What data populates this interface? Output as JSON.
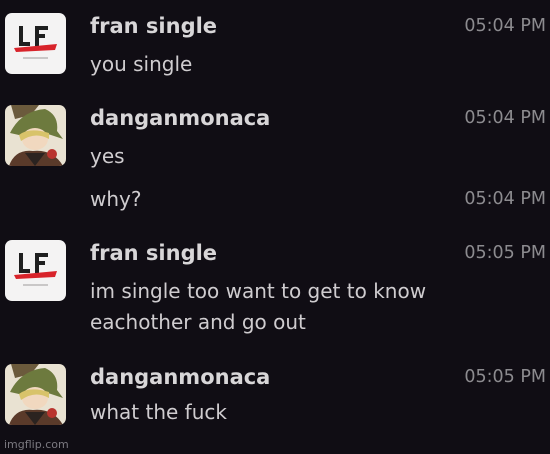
{
  "messages": [
    {
      "author": "fran single",
      "avatar": "lf-logo-avatar-icon",
      "time": "05:04 PM",
      "lines": [
        "you single"
      ]
    },
    {
      "author": "danganmonaca",
      "avatar": "anime-character-avatar-icon",
      "time": "05:04 PM",
      "lines": [
        "yes"
      ]
    },
    {
      "author": "",
      "avatar": "",
      "time": "05:04 PM",
      "lines": [
        "why?"
      ]
    },
    {
      "author": "fran single",
      "avatar": "lf-logo-avatar-icon",
      "time": "05:05 PM",
      "lines": [
        "im single too want to get to know",
        "eachother and go out"
      ]
    },
    {
      "author": "danganmonaca",
      "avatar": "anime-character-avatar-icon",
      "time": "05:05 PM",
      "lines": [
        "what the fuck"
      ]
    }
  ],
  "watermark": "imgflip.com",
  "colors": {
    "background": "#100d14",
    "author": "#d8d6d8",
    "text": "#cfcccf",
    "time": "#8c8b8f",
    "logo_red": "#d8232a"
  }
}
